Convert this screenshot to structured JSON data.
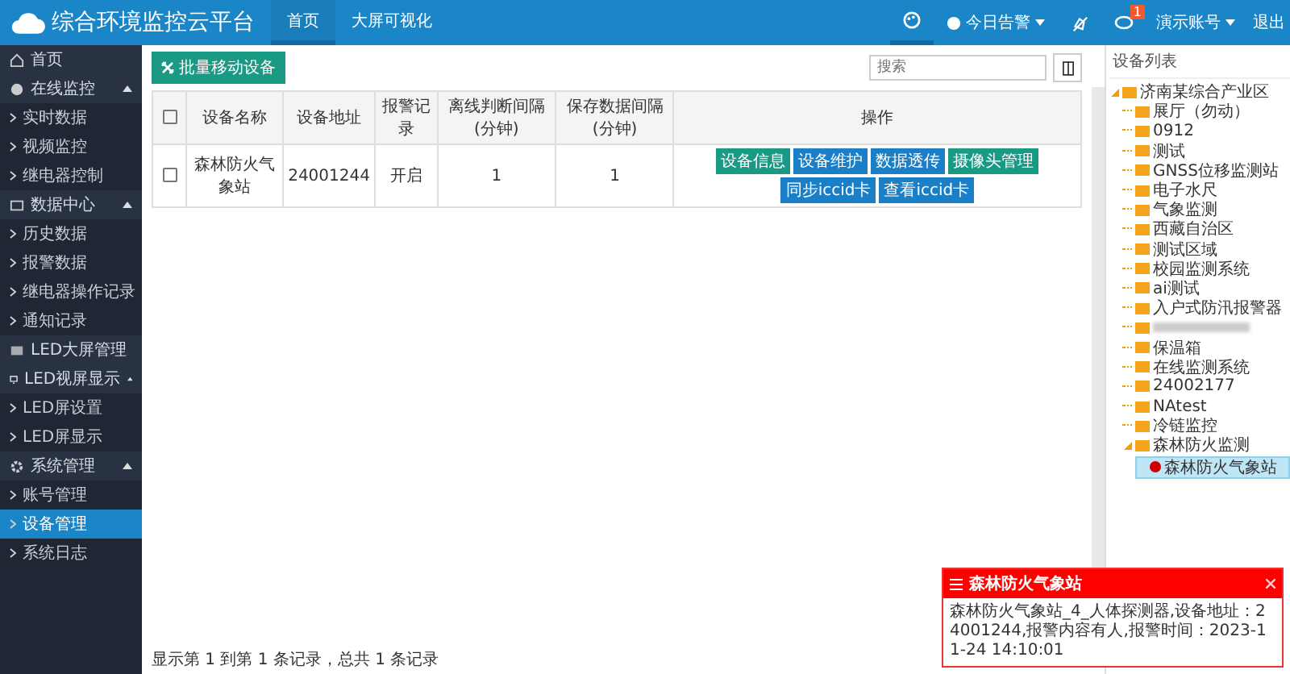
{
  "header": {
    "title": "综合环境监控云平台",
    "nav": [
      {
        "label": "首页",
        "selected": true
      },
      {
        "label": "大屏可视化",
        "selected": false
      }
    ],
    "alarm_menu": "今日告警",
    "alarm_badge": "1",
    "account_menu": "演示账号",
    "logout": "退出"
  },
  "sidebar": {
    "items": [
      {
        "label": "首页"
      },
      {
        "label": "在线监控",
        "expanded": true,
        "children": [
          {
            "label": "实时数据",
            "selected": false
          },
          {
            "label": "视频监控",
            "selected": false
          },
          {
            "label": "继电器控制",
            "selected": false
          }
        ]
      },
      {
        "label": "数据中心",
        "expanded": true,
        "children": [
          {
            "label": "历史数据",
            "selected": false
          },
          {
            "label": "报警数据",
            "selected": false
          },
          {
            "label": "继电器操作记录",
            "selected": false
          },
          {
            "label": "通知记录",
            "selected": false
          }
        ]
      },
      {
        "label": "LED大屏管理"
      },
      {
        "label": "LED视屏显示",
        "expanded": true,
        "children": [
          {
            "label": "LED屏设置",
            "selected": false
          },
          {
            "label": "LED屏显示",
            "selected": false
          }
        ]
      },
      {
        "label": "系统管理",
        "expanded": true,
        "children": [
          {
            "label": "账号管理",
            "selected": false
          },
          {
            "label": "设备管理",
            "selected": true
          },
          {
            "label": "系统日志",
            "selected": false
          }
        ]
      }
    ]
  },
  "toolbar": {
    "batch_button": "批量移动设备",
    "search": {
      "placeholder": "搜索"
    }
  },
  "table": {
    "all_checked": false,
    "columns": [
      "设备名称",
      "设备地址",
      "报警记录",
      "离线判断间隔(分钟)",
      "保存数据间隔(分钟)",
      "操作"
    ],
    "rows": [
      {
        "checked": false,
        "cells": [
          "森林防火气象站",
          "24001244",
          "开启",
          "1",
          "1"
        ],
        "actions": [
          {
            "label": "设备信息",
            "kind": "success"
          },
          {
            "label": "设备维护",
            "kind": "primary"
          },
          {
            "label": "数据透传",
            "kind": "primary"
          },
          {
            "label": "摄像头管理",
            "kind": "success"
          },
          {
            "label": "同步iccid卡",
            "kind": "primary"
          },
          {
            "label": "查看iccid卡",
            "kind": "primary"
          }
        ]
      }
    ],
    "footer": "显示第 1 到第 1 条记录，总共 1 条记录"
  },
  "device_tree": {
    "title": "设备列表",
    "root": {
      "label": "济南某综合产业区",
      "expanded": true,
      "children": [
        {
          "label": "展厅（勿动）"
        },
        {
          "label": "0912"
        },
        {
          "label": "测试"
        },
        {
          "label": "GNSS位移监测站"
        },
        {
          "label": "电子水尺"
        },
        {
          "label": "气象监测"
        },
        {
          "label": "西藏自治区"
        },
        {
          "label": "测试区域"
        },
        {
          "label": "校园监测系统"
        },
        {
          "label": "ai测试"
        },
        {
          "label": "入户式防汛报警器"
        },
        {
          "blurred": true
        },
        {
          "label": "保温箱"
        },
        {
          "label": "在线监测系统"
        },
        {
          "label": "24002177"
        },
        {
          "label": "NAtest"
        },
        {
          "label": "冷链监控"
        },
        {
          "label": "森林防火监测",
          "expanded": true,
          "children": [
            {
              "label": "森林防火气象站",
              "selected": true
            }
          ]
        }
      ]
    }
  },
  "alarm_popup": {
    "title": "森林防火气象站",
    "message": "森林防火气象站_4_人体探测器,设备地址：24001244,报警内容有人,报警时间：2023-11-24 14:10:01"
  }
}
